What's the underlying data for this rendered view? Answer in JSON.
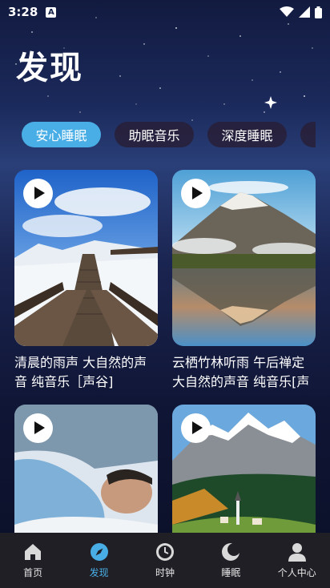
{
  "status_bar": {
    "time": "3:28",
    "app_icon_letter": "A"
  },
  "page": {
    "title": "发现"
  },
  "tabs": [
    {
      "label": "安心睡眠",
      "active": true
    },
    {
      "label": "助眠音乐",
      "active": false
    },
    {
      "label": "深度睡眠",
      "active": false
    }
  ],
  "cards": [
    {
      "title": "清晨的雨声 大自然的声音 纯音乐［声谷]",
      "image": "snowy-boardwalk"
    },
    {
      "title": "云栖竹林听雨 午后禅定 大自然的声音 纯音乐[声",
      "image": "mountain-lake"
    },
    {
      "title": "",
      "image": "sleeping-man"
    },
    {
      "title": "",
      "image": "alpine-village"
    }
  ],
  "bottom_nav": [
    {
      "label": "首页",
      "icon": "home-icon",
      "active": false
    },
    {
      "label": "发现",
      "icon": "compass-icon",
      "active": true
    },
    {
      "label": "时钟",
      "icon": "clock-icon",
      "active": false
    },
    {
      "label": "睡眠",
      "icon": "moon-icon",
      "active": false
    },
    {
      "label": "个人中心",
      "icon": "person-icon",
      "active": false
    }
  ],
  "colors": {
    "accent": "#49aee6",
    "nav_bg": "#1f1f25",
    "tab_bg": "#281e37"
  }
}
